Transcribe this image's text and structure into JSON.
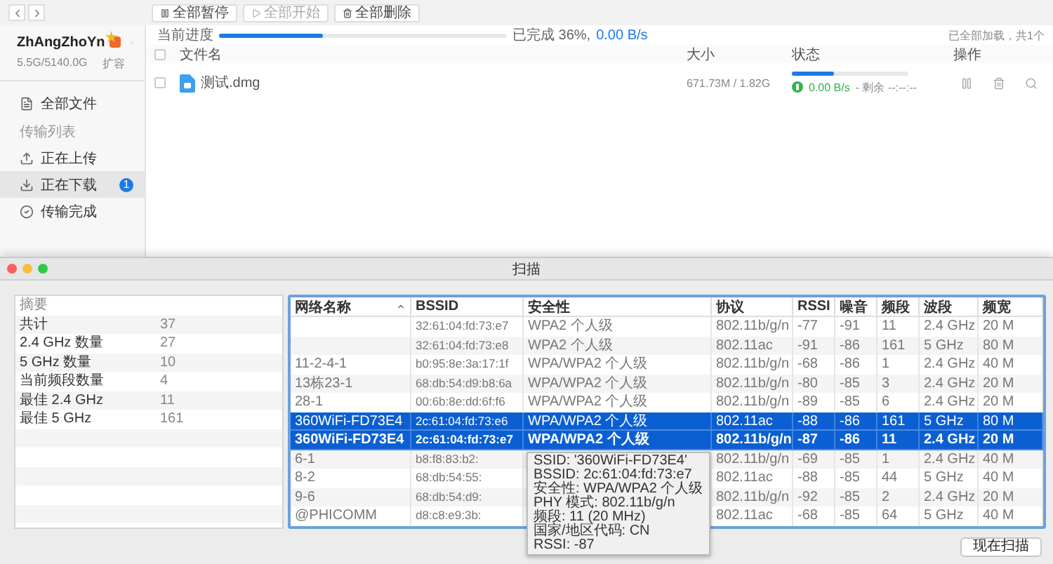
{
  "toolbar": {
    "buttons": [
      {
        "label": "全部暂停",
        "disabled": false
      },
      {
        "label": "全部开始",
        "disabled": true
      },
      {
        "label": "全部删除",
        "disabled": false
      }
    ]
  },
  "account": {
    "name": "ZhAngZhoYn",
    "storage": "5.5G/5140.0G",
    "expand": "扩容"
  },
  "sidebar": {
    "top_items": [
      {
        "label": "全部文件",
        "selected": false
      }
    ],
    "section_label": "传输列表",
    "transfer_items": [
      {
        "label": "正在上传",
        "selected": false
      },
      {
        "label": "正在下载",
        "selected": true,
        "badge": "1"
      },
      {
        "label": "传输完成",
        "selected": false
      }
    ]
  },
  "progress": {
    "label": "当前进度",
    "level": 0.36,
    "done": "已完成 36%,",
    "speed": "0.00 B/s",
    "summary": "已全部加载，共1个"
  },
  "file_table": {
    "header_checked": false,
    "columns": [
      "文件名",
      "大小",
      "状态",
      "操作"
    ],
    "rows": [
      {
        "name": "测试.dmg",
        "checked": false,
        "size": "671.73M / 1.82G",
        "level": 0.36,
        "speed": "0.00 B/s",
        "remaining": "- 剩余 --:--:--"
      }
    ]
  },
  "scan_window": {
    "title": "扫描",
    "summary": {
      "header": "摘要",
      "rows": [
        {
          "key": "共计",
          "value": "37"
        },
        {
          "key": "2.4 GHz 数量",
          "value": "27"
        },
        {
          "key": "5 GHz 数量",
          "value": "10"
        },
        {
          "key": "当前频段数量",
          "value": "4"
        },
        {
          "key": "最佳 2.4 GHz",
          "value": "11"
        },
        {
          "key": "最佳 5 GHz",
          "value": "161"
        }
      ]
    },
    "networks": {
      "columns": [
        {
          "label": "网络名称",
          "sorted": true
        },
        {
          "label": "BSSID"
        },
        {
          "label": "安全性"
        },
        {
          "label": "协议"
        },
        {
          "label": "RSSI"
        },
        {
          "label": "噪音"
        },
        {
          "label": "频段"
        },
        {
          "label": "波段"
        },
        {
          "label": "频宽"
        }
      ],
      "rows": [
        {
          "selected": false,
          "focused": false,
          "cells": [
            "",
            "32:61:04:fd:73:e7",
            "WPA2 个人级",
            "802.11b/g/n",
            "-77",
            "-91",
            "11",
            "2.4 GHz",
            "20 M"
          ]
        },
        {
          "selected": false,
          "focused": false,
          "cells": [
            "",
            "32:61:04:fd:73:e8",
            "WPA2 个人级",
            "802.11ac",
            "-91",
            "-86",
            "161",
            "5 GHz",
            "80 M"
          ]
        },
        {
          "selected": false,
          "focused": false,
          "cells": [
            "11-2-4-1",
            "b0:95:8e:3a:17:1f",
            "WPA/WPA2 个人级",
            "802.11b/g/n",
            "-68",
            "-86",
            "1",
            "2.4 GHz",
            "40 M"
          ]
        },
        {
          "selected": false,
          "focused": false,
          "cells": [
            "13栋23-1",
            "68:db:54:d9:b8:6a",
            "WPA/WPA2 个人级",
            "802.11b/g/n",
            "-80",
            "-85",
            "3",
            "2.4 GHz",
            "20 M"
          ]
        },
        {
          "selected": false,
          "focused": false,
          "cells": [
            "28-1",
            "00:6b:8e:dd:6f:f6",
            "WPA/WPA2 个人级",
            "802.11b/g/n",
            "-89",
            "-85",
            "6",
            "2.4 GHz",
            "20 M"
          ]
        },
        {
          "selected": true,
          "focused": false,
          "cells": [
            "360WiFi-FD73E4",
            "2c:61:04:fd:73:e6",
            "WPA/WPA2 个人级",
            "802.11ac",
            "-88",
            "-86",
            "161",
            "5 GHz",
            "80 M"
          ]
        },
        {
          "selected": true,
          "focused": true,
          "cells": [
            "360WiFi-FD73E4",
            "2c:61:04:fd:73:e7",
            "WPA/WPA2 个人级",
            "802.11b/g/n",
            "-87",
            "-86",
            "11",
            "2.4 GHz",
            "20 M"
          ]
        },
        {
          "selected": false,
          "focused": false,
          "cells": [
            "6-1",
            "b8:f8:83:b2:",
            "",
            "802.11b/g/n",
            "-69",
            "-85",
            "1",
            "2.4 GHz",
            "40 M"
          ]
        },
        {
          "selected": false,
          "focused": false,
          "cells": [
            "8-2",
            "68:db:54:55:",
            "",
            "802.11ac",
            "-88",
            "-85",
            "44",
            "5 GHz",
            "40 M"
          ]
        },
        {
          "selected": false,
          "focused": false,
          "cells": [
            "9-6",
            "68:db:54:d9:",
            "",
            "802.11b/g/n",
            "-92",
            "-85",
            "2",
            "2.4 GHz",
            "20 M"
          ]
        },
        {
          "selected": false,
          "focused": false,
          "cells": [
            "@PHICOMM",
            "d8:c8:e9:3b:",
            "",
            "802.11ac",
            "-68",
            "-85",
            "64",
            "5 GHz",
            "40 M"
          ]
        }
      ]
    },
    "tooltip": [
      "SSID: '360WiFi-FD73E4'",
      "BSSID: 2c:61:04:fd:73:e7",
      "安全性: WPA/WPA2 个人级",
      "PHY 模式: 802.11b/g/n",
      "频段: 11 (20 MHz)",
      "国家/地区代码: CN",
      "RSSI: -87"
    ],
    "scan_button": "现在扫描"
  }
}
